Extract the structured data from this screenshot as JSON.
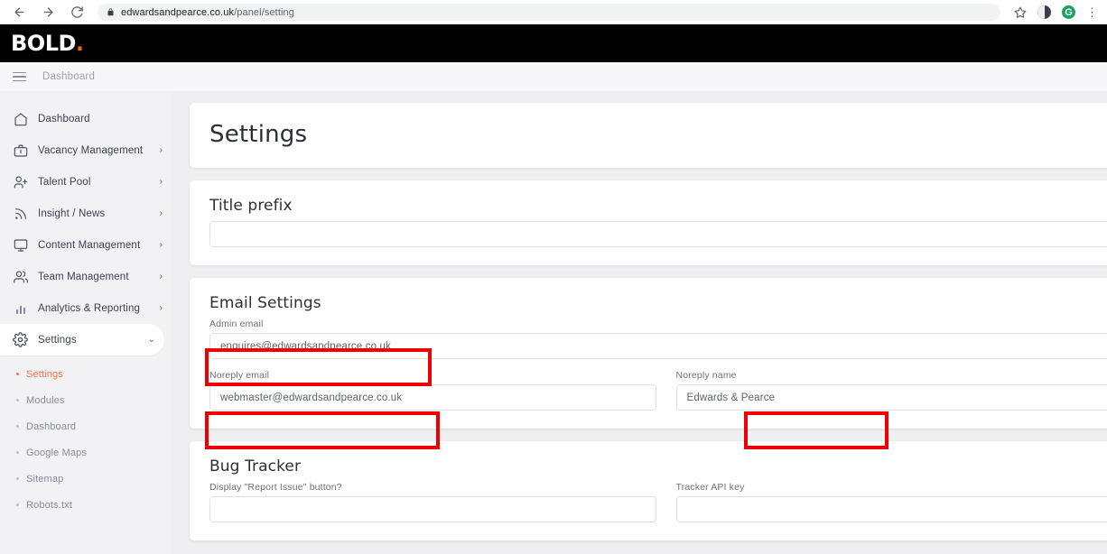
{
  "browser": {
    "back_icon": "back-arrow-icon",
    "forward_icon": "forward-arrow-icon",
    "reload_icon": "reload-icon",
    "lock_icon": "lock-icon",
    "url_domain": "edwardsandpearce.co.uk",
    "url_path": "/panel/setting",
    "star_icon": "bookmark-star-icon",
    "extension_1": "extension-icon",
    "extension_2": "profile-avatar-icon",
    "menu_icon": "kebab-menu-icon"
  },
  "app_header": {
    "logo_text": "BOLD",
    "logo_dot": ".",
    "logo_dot_color": "#f26522"
  },
  "top_bar": {
    "menu_icon": "hamburger-menu-icon",
    "breadcrumb": "Dashboard"
  },
  "sidebar": {
    "items": [
      {
        "label": "Dashboard",
        "icon": "home-icon",
        "chevron": "",
        "active": false
      },
      {
        "label": "Vacancy Management",
        "icon": "briefcase-icon",
        "chevron": "›",
        "active": false
      },
      {
        "label": "Talent Pool",
        "icon": "user-plus-icon",
        "chevron": "›",
        "active": false
      },
      {
        "label": "Insight / News",
        "icon": "rss-icon",
        "chevron": "›",
        "active": false
      },
      {
        "label": "Content Management",
        "icon": "monitor-icon",
        "chevron": "›",
        "active": false
      },
      {
        "label": "Team Management",
        "icon": "users-icon",
        "chevron": "›",
        "active": false
      },
      {
        "label": "Analytics & Reporting",
        "icon": "bar-chart-icon",
        "chevron": "›",
        "active": false
      },
      {
        "label": "Settings",
        "icon": "gear-icon",
        "chevron": "⌄",
        "active": true
      }
    ],
    "subitems": [
      {
        "label": "Settings",
        "active": true
      },
      {
        "label": "Modules",
        "active": false
      },
      {
        "label": "Dashboard",
        "active": false
      },
      {
        "label": "Google Maps",
        "active": false
      },
      {
        "label": "Sitemap",
        "active": false
      },
      {
        "label": "Robots.txt",
        "active": false
      }
    ],
    "active_color": "#f0744a"
  },
  "main": {
    "page_title": "Settings",
    "title_prefix": {
      "heading": "Title prefix",
      "value": "",
      "placeholder": ""
    },
    "email_settings": {
      "heading": "Email Settings",
      "admin_email_label": "Admin email",
      "admin_email_value": "enquires@edwardsandpearce.co.uk",
      "noreply_email_label": "Noreply email",
      "noreply_email_value": "webmaster@edwardsandpearce.co.uk",
      "noreply_name_label": "Noreply name",
      "noreply_name_value": "Edwards & Pearce"
    },
    "bug_tracker": {
      "heading": "Bug Tracker",
      "display_button_label": "Display \"Report Issue\" button?",
      "display_button_value": "",
      "api_key_label": "Tracker API key",
      "api_key_value": ""
    }
  },
  "annotations": {
    "highlight_color": "#ef0000",
    "boxes": [
      {
        "name": "admin-email-highlight"
      },
      {
        "name": "noreply-email-highlight"
      },
      {
        "name": "noreply-name-highlight"
      }
    ]
  }
}
